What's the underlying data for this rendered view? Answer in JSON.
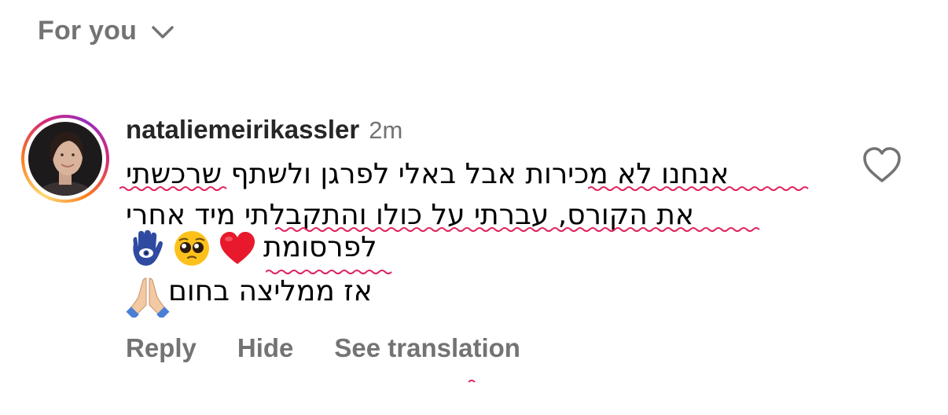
{
  "header": {
    "sort_label": "For you",
    "sort_icon": "chevron-down-icon"
  },
  "comment": {
    "avatar_icon": "profile-photo",
    "username": "nataliemeirikassler",
    "time": "2m",
    "lines": [
      "אנחנו לא מכירות אבל באלי לפרגן ולשתף שרכשתי",
      "את הקורס, עברתי על כולו והתקבלתי מיד אחרי",
      "לפרסומת",
      "אז ממליצה בחום"
    ],
    "emojis_line3": [
      "hamsa",
      "pleading-face",
      "red-heart"
    ],
    "emoji_line4": "folded-hands",
    "like_icon": "heart-outline-icon"
  },
  "actions": {
    "reply": "Reply",
    "hide": "Hide",
    "translate": "See translation"
  },
  "colors": {
    "primary_text": "#262626",
    "secondary_text": "#737373",
    "spellcheck": "#e0245e"
  }
}
